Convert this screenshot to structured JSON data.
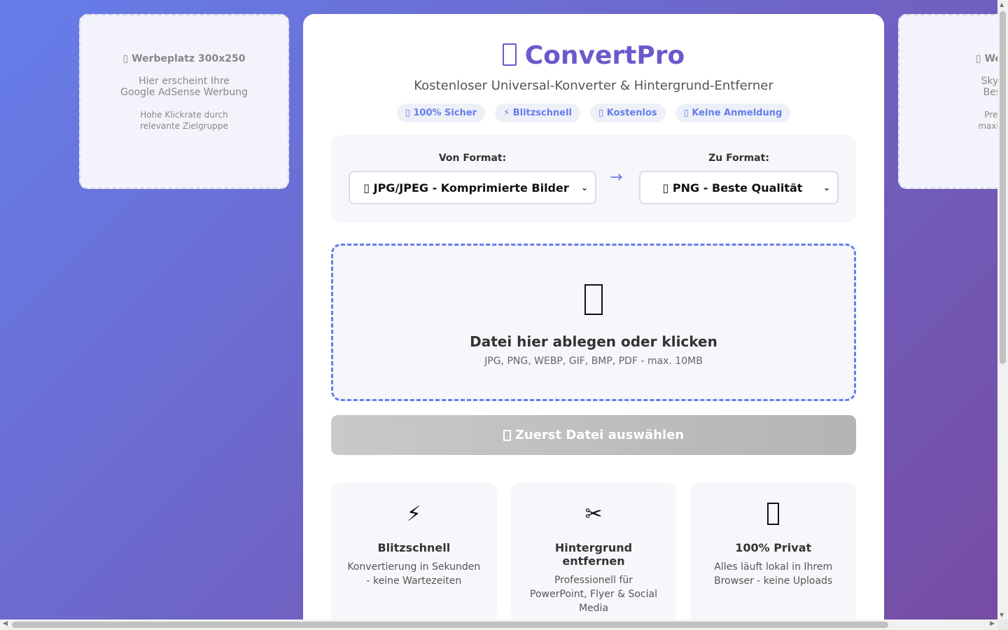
{
  "ad_left": {
    "title": "Werbeplatz 300x250",
    "desc_line1": "Hier erscheint Ihre",
    "desc_line2": "Google AdSense Werbung",
    "note_line1": "Hohe Klickrate durch",
    "note_line2": "relevante Zielgruppe"
  },
  "ad_right": {
    "title": "Werbepl",
    "desc_line1": "Skyscrap",
    "desc_line2": "Beste Si",
    "note_line1": "Premium",
    "note_line2": "maximale A"
  },
  "header": {
    "logo": "ConvertPro",
    "subtitle": "Kostenloser Universal-Konverter & Hintergrund-Entferner",
    "badges": [
      "100% Sicher",
      "⚡ Blitzschnell",
      "Kostenlos",
      "Keine Anmeldung"
    ]
  },
  "format": {
    "from_label": "Von Format:",
    "from_value": "JPG/JPEG - Komprimierte Bilder",
    "to_label": "Zu Format:",
    "to_value": "PNG - Beste Qualität",
    "arrow": "→"
  },
  "dropzone": {
    "title": "Datei hier ablegen oder klicken",
    "subtitle": "JPG, PNG, WEBP, GIF, BMP, PDF - max. 10MB"
  },
  "convert_button": {
    "label": "Zuerst Datei auswählen"
  },
  "features": [
    {
      "icon": "⚡",
      "title": "Blitzschnell",
      "desc": "Konvertierung in Sekunden - keine Wartezeiten"
    },
    {
      "icon": "✂",
      "title": "Hintergrund entfernen",
      "desc": "Professionell für PowerPoint, Flyer & Social Media"
    },
    {
      "icon": "lock-icon",
      "title": "100% Privat",
      "desc": "Alles läuft lokal in Ihrem Browser - keine Uploads"
    }
  ],
  "colors": {
    "accent": "#667eea",
    "brand": "#6a5acd",
    "bg_start": "#667eea",
    "bg_end": "#764ba2"
  }
}
